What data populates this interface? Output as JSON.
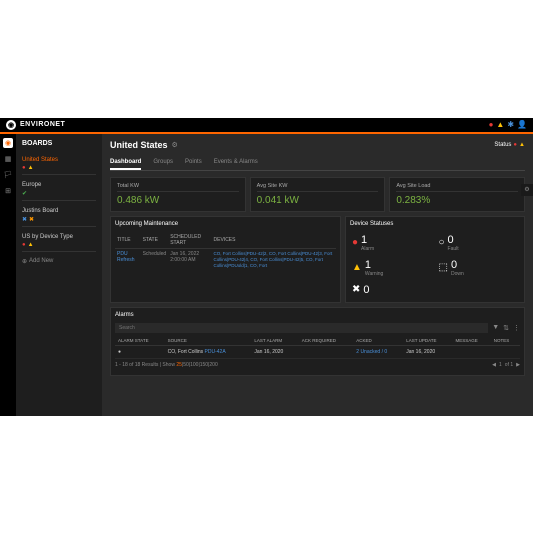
{
  "app": {
    "name": "ENVIRONET"
  },
  "sidebar": {
    "title": "BOARDS",
    "items": [
      {
        "name": "United States",
        "active": true
      },
      {
        "name": "Europe"
      },
      {
        "name": "Justins Board"
      },
      {
        "name": "US by Device Type"
      }
    ],
    "addNew": "Add New"
  },
  "header": {
    "title": "United States",
    "statusLabel": "Status"
  },
  "tabs": [
    "Dashboard",
    "Groups",
    "Points",
    "Events & Alarms"
  ],
  "metrics": [
    {
      "label": "Total KW",
      "value": "0.486 kW"
    },
    {
      "label": "Avg Site KW",
      "value": "0.041 kW"
    },
    {
      "label": "Avg Site Load",
      "value": "0.283%"
    }
  ],
  "maintenance": {
    "title": "Upcoming Maintenance",
    "headers": [
      "TITLE",
      "STATE",
      "SCHEDULED START",
      "DEVICES"
    ],
    "row": {
      "title": "PDU Refresh",
      "state": "Scheduled",
      "start": "Jan 16, 2022 2:00:00 AM",
      "devicesText": "CO, Fort Collins|PDU-42|2, CO, Fort Collins|PDU-42|3, Fort Collins|PDU-42|4, CO, Fort Collins|PDU-42|5, CO, Fort Collins|PDUold|1, CO, Fort"
    }
  },
  "deviceStatuses": {
    "title": "Device Statuses",
    "items": [
      {
        "icon": "●",
        "cls": "red",
        "num": "1",
        "label": "Alarm"
      },
      {
        "icon": "○",
        "cls": "white",
        "num": "0",
        "label": "Fault"
      },
      {
        "icon": "▲",
        "cls": "yellow",
        "num": "1",
        "label": "Warning"
      },
      {
        "icon": "⬚",
        "cls": "white",
        "num": "0",
        "label": "Down"
      },
      {
        "icon": "✖",
        "cls": "white",
        "num": "0",
        "label": ""
      },
      {
        "icon": "",
        "cls": "",
        "num": "",
        "label": ""
      }
    ]
  },
  "alarms": {
    "title": "Alarms",
    "searchPlaceholder": "Search",
    "headers": [
      "ALARM STATE",
      "SOURCE",
      "LAST ALARM",
      "ACK REQUIRED",
      "ACKED",
      "LAST UPDATE",
      "MESSAGE",
      "NOTES"
    ],
    "row": {
      "state": "●",
      "source": "CO, Fort Collins",
      "sourceLink": "PDU-42A",
      "lastAlarm": "Jan 16, 2020",
      "ackRequired": "",
      "acked": "2 Unacked / 0",
      "lastUpdate": "Jan 16, 2020",
      "message": "",
      "notes": ""
    },
    "pagination": {
      "results": "1 - 18 of 18 Results | Show",
      "sizes": [
        "25",
        "50",
        "100",
        "150",
        "200"
      ],
      "page": "1",
      "of": "of 1"
    }
  }
}
